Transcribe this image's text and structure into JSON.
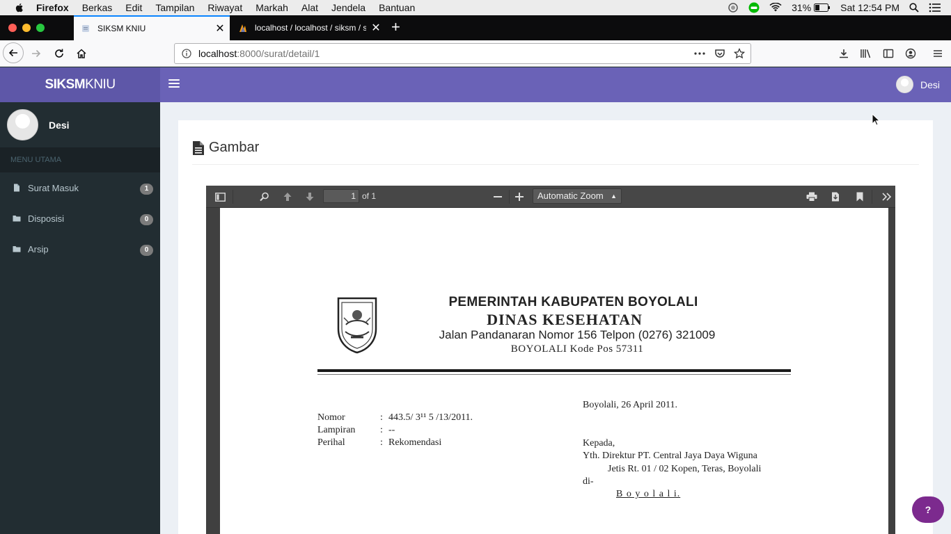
{
  "menubar": {
    "app_name": "Firefox",
    "items": [
      "Berkas",
      "Edit",
      "Tampilan",
      "Riwayat",
      "Markah",
      "Alat",
      "Jendela",
      "Bantuan"
    ],
    "battery": "31%",
    "clock": "Sat 12:54 PM"
  },
  "tabs": [
    {
      "title": "SIKSM KNIU",
      "active": true
    },
    {
      "title": "localhost / localhost / siksm / su",
      "active": false
    }
  ],
  "url": {
    "host": "localhost",
    "rest": ":8000/surat/detail/1"
  },
  "app": {
    "brand_bold": "SIKSM",
    "brand_rest": "KNIU",
    "header_user": "Desi",
    "accent": "#6a62b7"
  },
  "sidebar": {
    "user_name": "Desi",
    "menu_header": "MENU UTAMA",
    "items": [
      {
        "label": "Surat Masuk",
        "count": "1",
        "icon": "file-icon"
      },
      {
        "label": "Disposisi",
        "count": "0",
        "icon": "folder-icon"
      },
      {
        "label": "Arsip",
        "count": "0",
        "icon": "folder-icon"
      }
    ]
  },
  "content": {
    "title": "Gambar"
  },
  "pdf_viewer": {
    "page_number": "1",
    "page_of": "of 1",
    "zoom": "Automatic Zoom"
  },
  "letter": {
    "gov": "PEMERINTAH KABUPATEN BOYOLALI",
    "agency": "DINAS KESEHATAN",
    "address": "Jalan Pandanaran Nomor 156 Telpon (0276) 321009",
    "city_line": "BOYOLALI  Kode Pos  57311",
    "date": "Boyolali,   26  April  2011.",
    "nomor_label": "Nomor",
    "lampiran_label": "Lampiran",
    "perihal_label": "Perihal",
    "colon": ":",
    "nomor_value": "443.5/ 3¹¹ 5 /13/2011.",
    "lampiran_value": "--",
    "perihal_value": "Rekomendasi",
    "kepada": "Kepada,",
    "yth": "Yth.  Direktur PT. Central Jaya Daya Wiguna",
    "alamat": "Jetis Rt. 01 / 02 Kopen, Teras, Boyolali",
    "di": "di-",
    "kota": "B o y o l a l i."
  },
  "help_button": "?"
}
